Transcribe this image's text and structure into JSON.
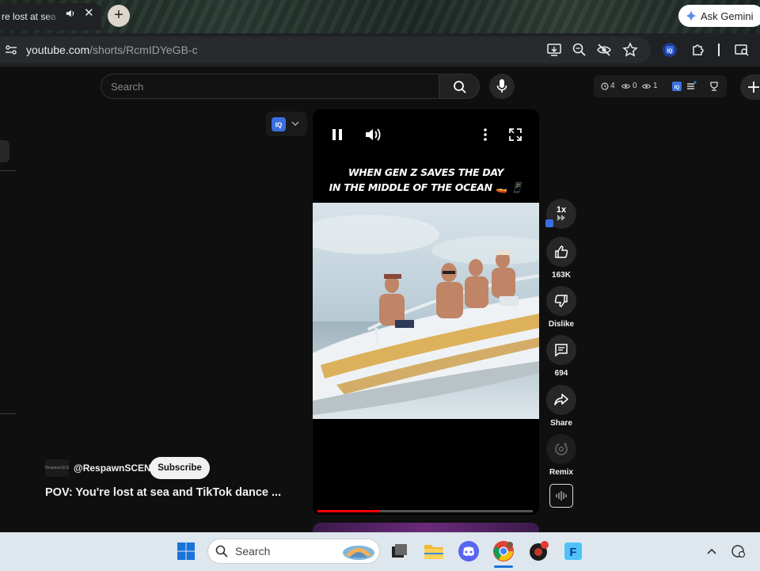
{
  "browser": {
    "tab": {
      "title": "POV: You're lost at sea and TikTok dance ...",
      "visible_title": "re lost at sea a",
      "close_glyph": "✕"
    },
    "new_tab_glyph": "+",
    "ask_gemini_label": "Ask Gemini",
    "address": {
      "host": "youtube.com",
      "path": "/shorts/RcmIDYeGB-c"
    }
  },
  "youtube": {
    "search_placeholder": "Search",
    "extension_stats": {
      "a": "4",
      "b": "0",
      "c": "1"
    },
    "iq_label": "IQ",
    "short": {
      "caption_line1": "WHEN GEN Z SAVES THE DAY",
      "caption_line2": "IN THE MIDDLE OF THE OCEAN 🚤 📱",
      "progress": 0.29
    },
    "actions": {
      "speed_label": "1x",
      "like_count": "163K",
      "dislike_label": "Dislike",
      "comment_count": "694",
      "share_label": "Share",
      "remix_label": "Remix"
    },
    "channel": {
      "handle": "@RespawnSCENE",
      "avatar_text": "RespawnSCENE",
      "subscribe_label": "Subscribe"
    },
    "video_title": "POV: You're lost at sea and TikTok dance ..."
  },
  "taskbar": {
    "search_label": "Search"
  },
  "colors": {
    "accent_red": "#ff0000",
    "iq_blue": "#3b6fe0"
  }
}
